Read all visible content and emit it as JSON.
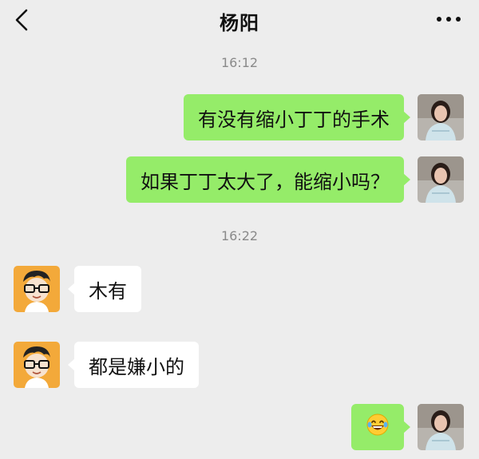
{
  "header": {
    "title": "杨阳",
    "back_icon": "chevron-left-icon",
    "more_icon": "more-dots-icon"
  },
  "timestamps": [
    "16:12",
    "16:22"
  ],
  "messages": [
    {
      "side": "right",
      "text": "有没有缩小丁丁的手术",
      "avatar": "woman-avatar"
    },
    {
      "side": "right",
      "text": "如果丁丁太大了，能缩小吗？",
      "avatar": "woman-avatar"
    },
    {
      "side": "left",
      "text": "木有",
      "avatar": "cartoon-boy-avatar"
    },
    {
      "side": "left",
      "text": "都是嫌小的",
      "avatar": "cartoon-boy-avatar"
    },
    {
      "side": "right",
      "text": "",
      "emoji": "tears-of-joy-emoji",
      "avatar": "woman-avatar"
    }
  ],
  "colors": {
    "background": "#ededed",
    "outgoing_bubble": "#95ec69",
    "incoming_bubble": "#ffffff",
    "timestamp_text": "#8a8a8a"
  }
}
